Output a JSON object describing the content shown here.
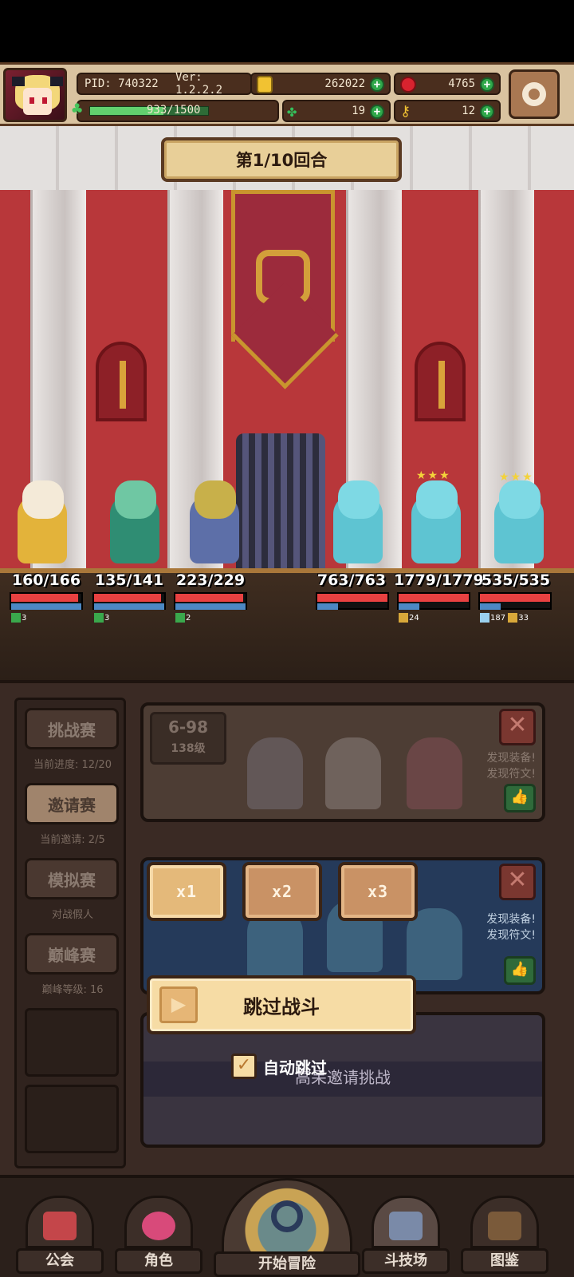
{
  "header": {
    "pid": "PID: 740322",
    "version": "Ver: 1.2.2.2",
    "coins": "262022",
    "gems": "4765",
    "exp": "933/1500",
    "exp_fraction": 0.62,
    "clover": "19",
    "keys": "12"
  },
  "battle": {
    "round": "第1/10回合",
    "allies": [
      {
        "hp": "160/166",
        "hp_fraction": 0.96,
        "buff": "3"
      },
      {
        "hp": "135/141",
        "hp_fraction": 0.96,
        "buff": "3"
      },
      {
        "hp": "223/229",
        "hp_fraction": 0.97,
        "buff": "2"
      }
    ],
    "enemies": [
      {
        "hp": "763/763",
        "hp_fraction": 1.0,
        "buffs": []
      },
      {
        "hp": "1779/1779",
        "hp_fraction": 1.0,
        "buffs": [
          "24"
        ]
      },
      {
        "hp": "535/535",
        "hp_fraction": 1.0,
        "buffs": [
          "187",
          "33"
        ]
      }
    ]
  },
  "modes": [
    {
      "label": "挑战赛",
      "sub": "当前进度: 12/20"
    },
    {
      "label": "邀请赛",
      "sub": "当前邀请: 2/5"
    },
    {
      "label": "模拟赛",
      "sub": "对战假人"
    },
    {
      "label": "巅峰赛",
      "sub": "巅峰等级: 16"
    }
  ],
  "cards": {
    "c1": {
      "stage": "6-98",
      "level": "138级",
      "found1": "发现装备!",
      "found2": "发现符文!"
    },
    "c2": {
      "found1": "发现装备!",
      "found2": "发现符文!"
    },
    "c3": {
      "title": "高呆邀请挑战"
    }
  },
  "overlay": {
    "speeds": [
      "x1",
      "x2",
      "x3"
    ],
    "selected_speed": "x1",
    "skip_label": "跳过战斗",
    "auto_skip_label": "自动跳过",
    "auto_skip_checked": true
  },
  "nav": {
    "guild": "公会",
    "role": "角色",
    "start": "开始冒险",
    "arena": "斗技场",
    "codex": "图鉴"
  }
}
